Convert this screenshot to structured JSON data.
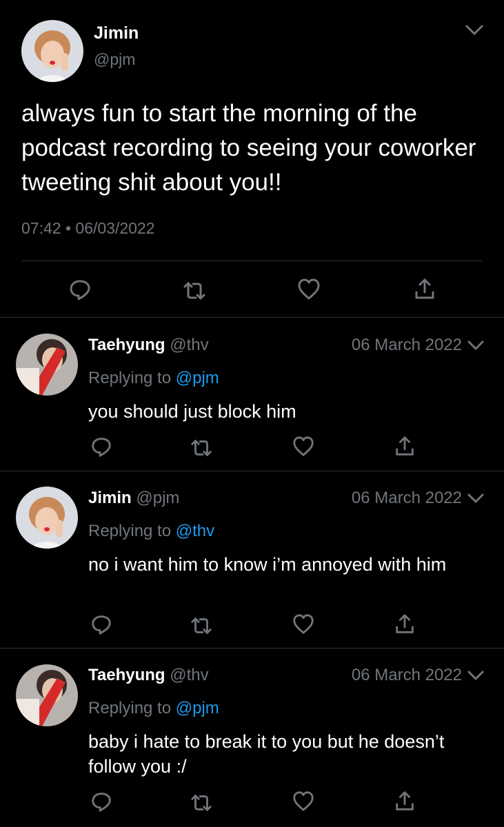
{
  "main_tweet": {
    "name": "Jimin",
    "handle": "@pjm",
    "text": "always fun to start the morning of the podcast recording to seeing your coworker tweeting shit about you!!",
    "time": "07:42",
    "separator": "•",
    "date": "06/03/2022"
  },
  "replies": [
    {
      "name": "Taehyung",
      "handle": "@thv",
      "date": "06 March 2022",
      "replying_prefix": "Replying to",
      "replying_to": "@pjm",
      "text": "you should just block him"
    },
    {
      "name": "Jimin",
      "handle": "@pjm",
      "date": "06 March 2022",
      "replying_prefix": "Replying to",
      "replying_to": "@thv",
      "text": "no i want him to know i’m annoyed with him"
    },
    {
      "name": "Taehyung",
      "handle": "@thv",
      "date": "06 March 2022",
      "replying_prefix": "Replying to",
      "replying_to": "@pjm",
      "text": "baby i hate to break it to you but he doesn’t follow you :/"
    }
  ],
  "icons": {
    "reply": "reply-icon",
    "retweet": "retweet-icon",
    "like": "heart-icon",
    "share": "share-icon",
    "more": "chevron-down-icon"
  },
  "colors": {
    "background": "#000000",
    "text": "#ffffff",
    "secondary": "#71767b",
    "link": "#1d9bf0",
    "divider": "#2f3336"
  }
}
